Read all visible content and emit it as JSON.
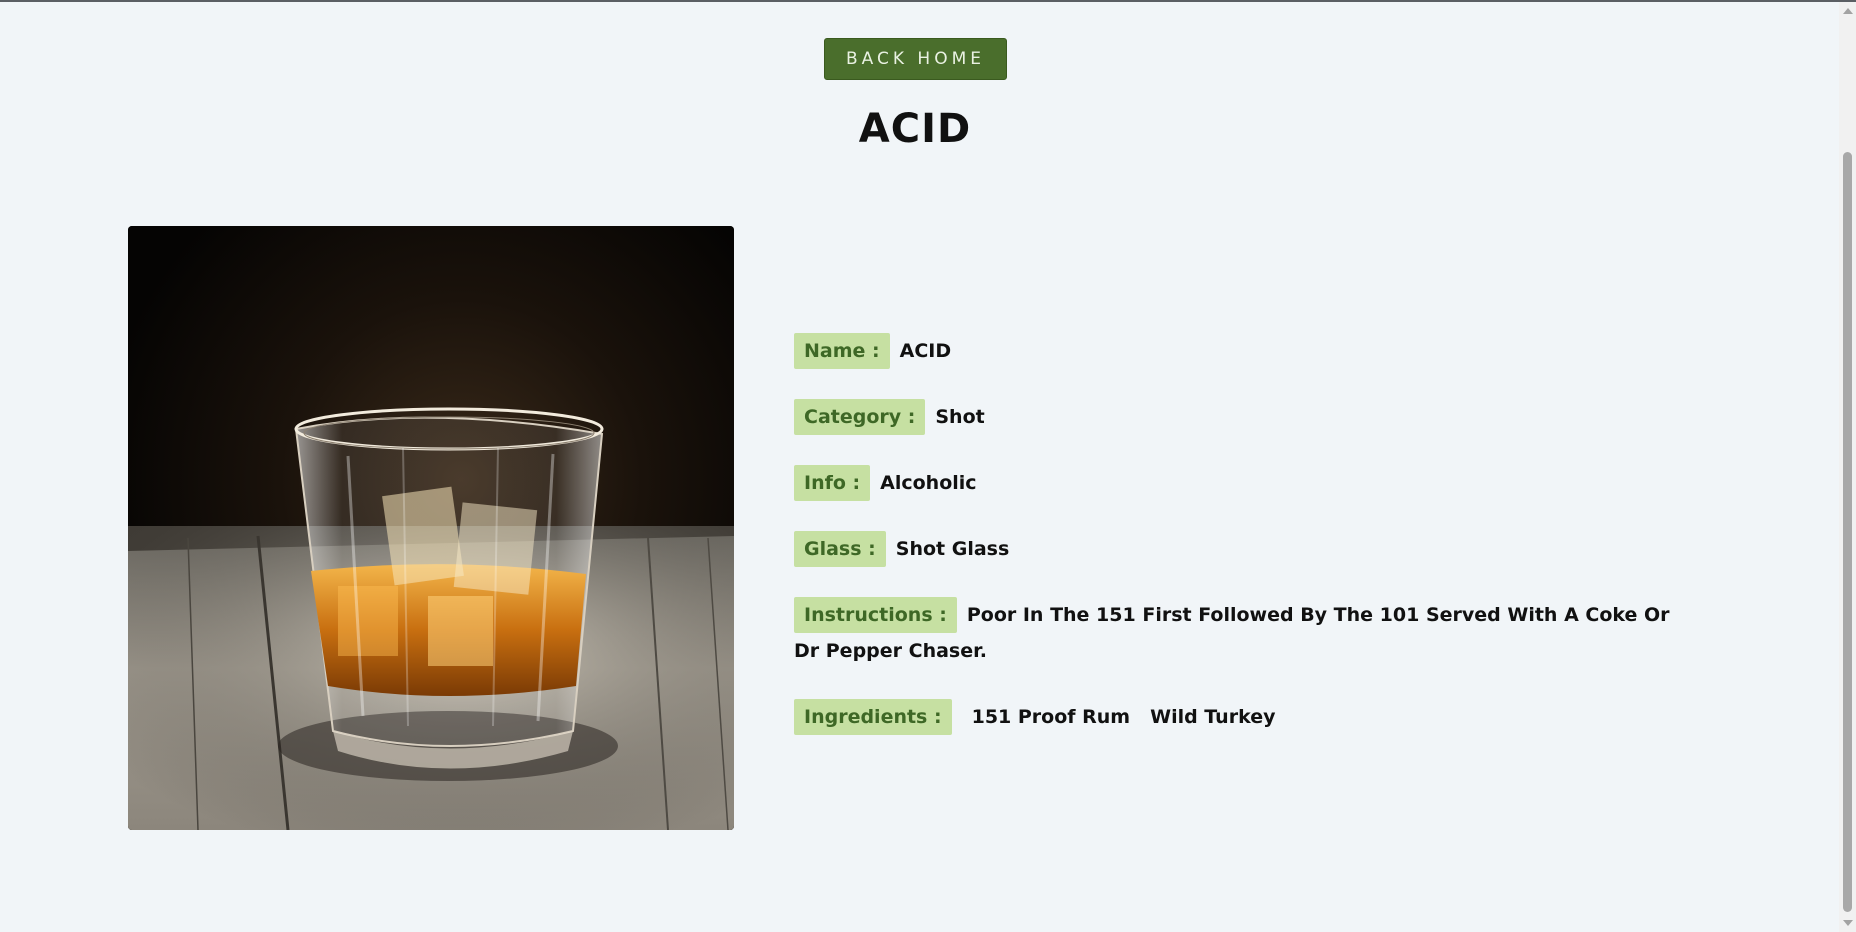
{
  "nav": {
    "back_label": "BACK HOME"
  },
  "drink": {
    "title": "ACID",
    "image_alt": "glass-of-whiskey-on-wooden-table",
    "fields": {
      "name_label": "Name :",
      "name_value": "ACID",
      "category_label": "Category :",
      "category_value": "Shot",
      "info_label": "Info :",
      "info_value": "Alcoholic",
      "glass_label": "Glass :",
      "glass_value": "Shot Glass",
      "instructions_label": "Instructions :",
      "instructions_value": "Poor In The 151 First Followed By The 101 Served With A Coke Or Dr Pepper Chaser.",
      "ingredients_label": "Ingredients :",
      "ingredients": [
        "151 Proof Rum",
        "Wild Turkey"
      ]
    }
  },
  "colors": {
    "background": "#f1f5f8",
    "button": "#4a6e2c",
    "tag_background": "#c6e0a2",
    "tag_text": "#3e6826"
  }
}
